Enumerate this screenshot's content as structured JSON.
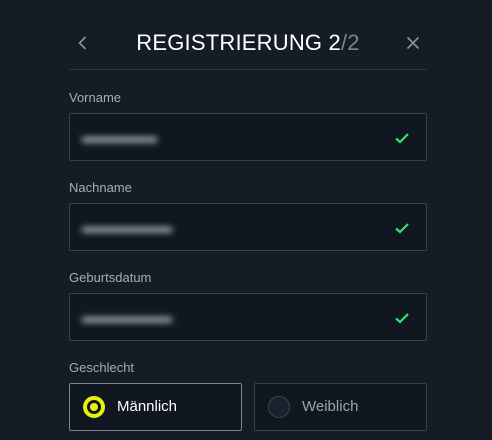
{
  "header": {
    "title_main": "REGISTRIERUNG 2",
    "title_total": "/2"
  },
  "form": {
    "first_name": {
      "label": "Vorname",
      "value": "▬▬▬▬▬"
    },
    "last_name": {
      "label": "Nachname",
      "value": "▬▬▬▬▬▬"
    },
    "birth_date": {
      "label": "Geburtsdatum",
      "value": "▬▬▬▬▬▬"
    },
    "gender": {
      "label": "Geschlecht",
      "male_label": "Männlich",
      "female_label": "Weiblich",
      "selected": "Männlich"
    }
  },
  "colors": {
    "background": "#141c26",
    "accent": "#e6f20a",
    "success": "#2ee66b"
  }
}
